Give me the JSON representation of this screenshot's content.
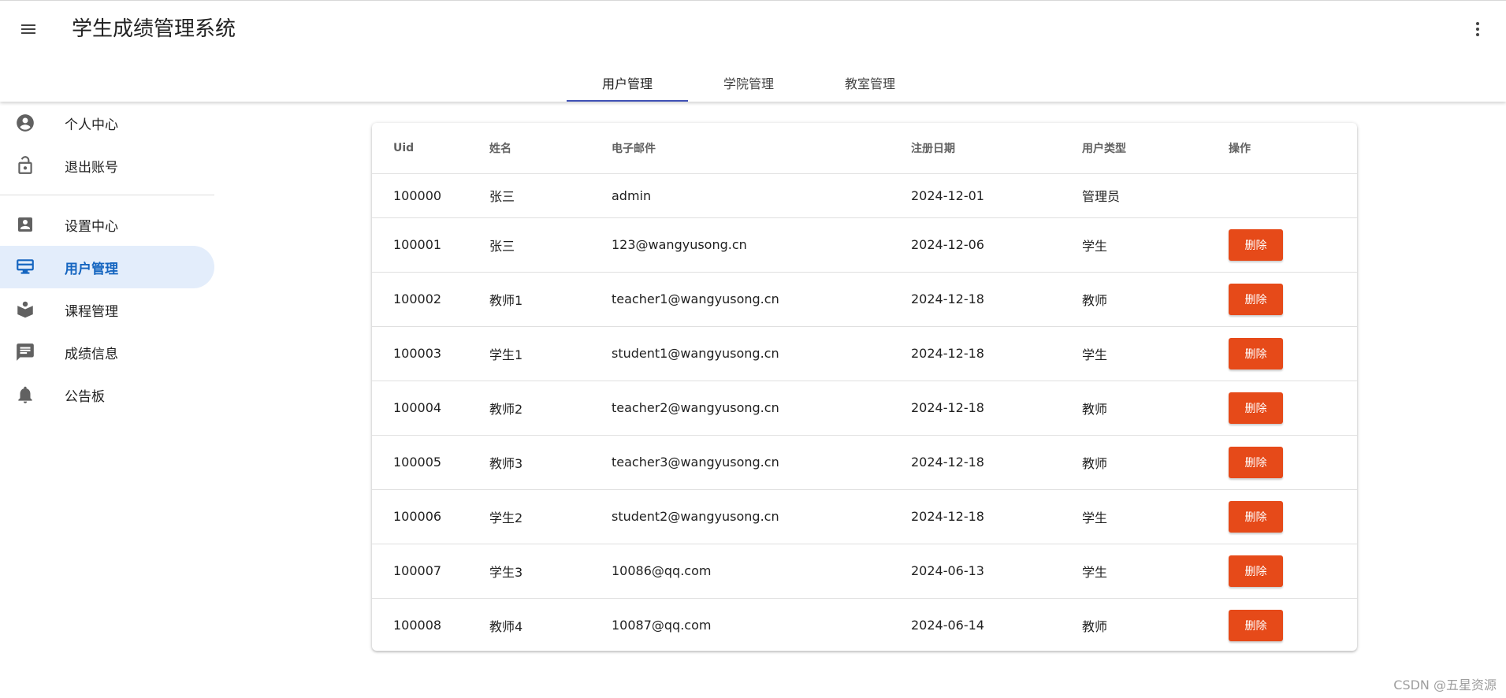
{
  "app": {
    "title": "学生成绩管理系统",
    "menu_icon": "hamburger-menu-icon",
    "more_icon": "more-vertical-icon"
  },
  "tabs": [
    {
      "label": "用户管理",
      "active": true
    },
    {
      "label": "学院管理",
      "active": false
    },
    {
      "label": "教室管理",
      "active": false
    }
  ],
  "sidebar": {
    "items": [
      {
        "label": "个人中心",
        "icon": "account-circle-icon"
      },
      {
        "label": "退出账号",
        "icon": "lock-open-icon"
      },
      {
        "label": "设置中心",
        "icon": "contact-card-icon"
      },
      {
        "label": "用户管理",
        "icon": "user-management-icon",
        "active": true
      },
      {
        "label": "课程管理",
        "icon": "book-open-icon"
      },
      {
        "label": "成绩信息",
        "icon": "message-icon"
      },
      {
        "label": "公告板",
        "icon": "bell-icon"
      }
    ]
  },
  "table": {
    "columns": [
      "Uid",
      "姓名",
      "电子邮件",
      "注册日期",
      "用户类型",
      "操作"
    ],
    "delete_label": "删除",
    "rows": [
      {
        "uid": "100000",
        "name": "张三",
        "email": "admin",
        "date": "2024-12-01",
        "type": "管理员",
        "deletable": false
      },
      {
        "uid": "100001",
        "name": "张三",
        "email": "123@wangyusong.cn",
        "date": "2024-12-06",
        "type": "学生",
        "deletable": true
      },
      {
        "uid": "100002",
        "name": "教师1",
        "email": "teacher1@wangyusong.cn",
        "date": "2024-12-18",
        "type": "教师",
        "deletable": true
      },
      {
        "uid": "100003",
        "name": "学生1",
        "email": "student1@wangyusong.cn",
        "date": "2024-12-18",
        "type": "学生",
        "deletable": true
      },
      {
        "uid": "100004",
        "name": "教师2",
        "email": "teacher2@wangyusong.cn",
        "date": "2024-12-18",
        "type": "教师",
        "deletable": true
      },
      {
        "uid": "100005",
        "name": "教师3",
        "email": "teacher3@wangyusong.cn",
        "date": "2024-12-18",
        "type": "教师",
        "deletable": true
      },
      {
        "uid": "100006",
        "name": "学生2",
        "email": "student2@wangyusong.cn",
        "date": "2024-12-18",
        "type": "学生",
        "deletable": true
      },
      {
        "uid": "100007",
        "name": "学生3",
        "email": "10086@qq.com",
        "date": "2024-06-13",
        "type": "学生",
        "deletable": true
      },
      {
        "uid": "100008",
        "name": "教师4",
        "email": "10087@qq.com",
        "date": "2024-06-14",
        "type": "教师",
        "deletable": true
      }
    ]
  },
  "watermark": "CSDN @五星资源",
  "colors": {
    "accent": "#3f51b5",
    "active_nav_bg": "#e3edfb",
    "active_nav_text": "#1565c0",
    "delete_button": "#e64a19"
  }
}
